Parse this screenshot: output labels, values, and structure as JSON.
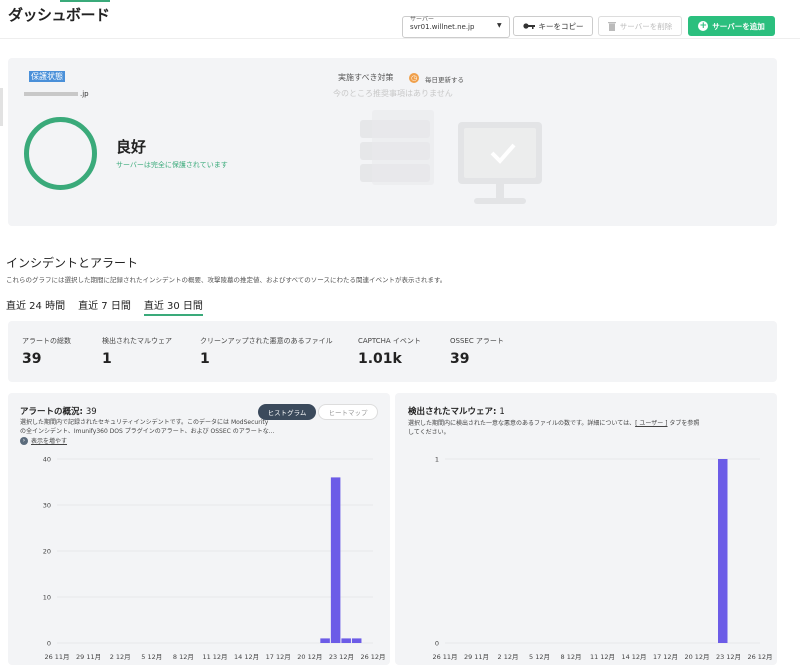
{
  "header": {
    "title": "ダッシュボード",
    "server_label": "サーバー",
    "server_value": "svr01.willnet.ne.jp",
    "copy_key": "キーをコピー",
    "delete_server": "サーバーを削除",
    "add_server": "サーバーを追加"
  },
  "protection": {
    "label": "保護状態",
    "domain": ".jp",
    "status": "良好",
    "status_sub": "サーバーは完全に保護されています",
    "recommend_title": "実施すべき対策",
    "daily_update": "毎日更新する",
    "recommend_empty": "今のところ推奨事項はありません"
  },
  "incidents": {
    "title": "インシデントとアラート",
    "description": "これらのグラフには選択した期間に記録されたインシデントの概要、攻撃陵墓の推定値、およびすべてのソースにわたる関連イベントが表示されます。",
    "periods": [
      "直近 24 時間",
      "直近 7 日間",
      "直近 30 日間"
    ],
    "active_period": 2
  },
  "stats": [
    {
      "label": "アラートの総数",
      "value": "39"
    },
    {
      "label": "検出されたマルウェア",
      "value": "1"
    },
    {
      "label": "クリーンアップされた悪意のあるファイル",
      "value": "1"
    },
    {
      "label": "CAPTCHA イベント",
      "value": "1.01k"
    },
    {
      "label": "OSSEC アラート",
      "value": "39"
    }
  ],
  "alerts_chart": {
    "title": "アラートの概況",
    "count": "39",
    "desc1": "選択した期間内で記録されたセキュリティインシデントです。このデータには ModSecurity",
    "desc2": "の全インシデント、Imunify360 DOS プラグインのアラート、および OSSEC のアラートな...",
    "show_more": "表示を増やす",
    "toggle_histogram": "ヒストグラム",
    "toggle_heatmap": "ヒートマップ"
  },
  "malware_chart": {
    "title": "検出されたマルウェア",
    "count": "1",
    "desc1a": "選択した期間内に検出された一意な悪意のあるファイルの数です。詳細については、",
    "desc1_link": "[ ユーザー ]",
    "desc1b": " タブを参照",
    "desc2": "してください。"
  },
  "chart_data": [
    {
      "type": "bar",
      "title": "アラートの概況",
      "x_ticks": [
        "26 11月",
        "29 11月",
        "2 12月",
        "5 12月",
        "8 12月",
        "11 12月",
        "14 12月",
        "17 12月",
        "20 12月",
        "23 12月",
        "26 12月"
      ],
      "y_ticks": [
        0,
        10,
        20,
        30,
        40
      ],
      "ylim": [
        0,
        40
      ],
      "x_start": "2024-11-26",
      "x_end": "2024-12-26",
      "bars": [
        {
          "date": "2024-12-21",
          "value": 1
        },
        {
          "date": "2024-12-22",
          "value": 36
        },
        {
          "date": "2024-12-23",
          "value": 1
        },
        {
          "date": "2024-12-24",
          "value": 1
        }
      ],
      "color": "#6c5ce7"
    },
    {
      "type": "bar",
      "title": "検出されたマルウェア",
      "x_ticks": [
        "26 11月",
        "29 11月",
        "2 12月",
        "5 12月",
        "8 12月",
        "11 12月",
        "14 12月",
        "17 12月",
        "20 12月",
        "23 12月",
        "26 12月"
      ],
      "y_ticks": [
        0,
        1
      ],
      "ylim": [
        0,
        1
      ],
      "x_start": "2024-11-26",
      "x_end": "2024-12-26",
      "bars": [
        {
          "date": "2024-12-22",
          "value": 1
        }
      ],
      "color": "#6c5ce7"
    }
  ],
  "colors": {
    "accent": "#2bbf7e",
    "status_green": "#3aaa7a",
    "bar": "#6c5ce7",
    "panel_bg": "#f3f4f6"
  }
}
